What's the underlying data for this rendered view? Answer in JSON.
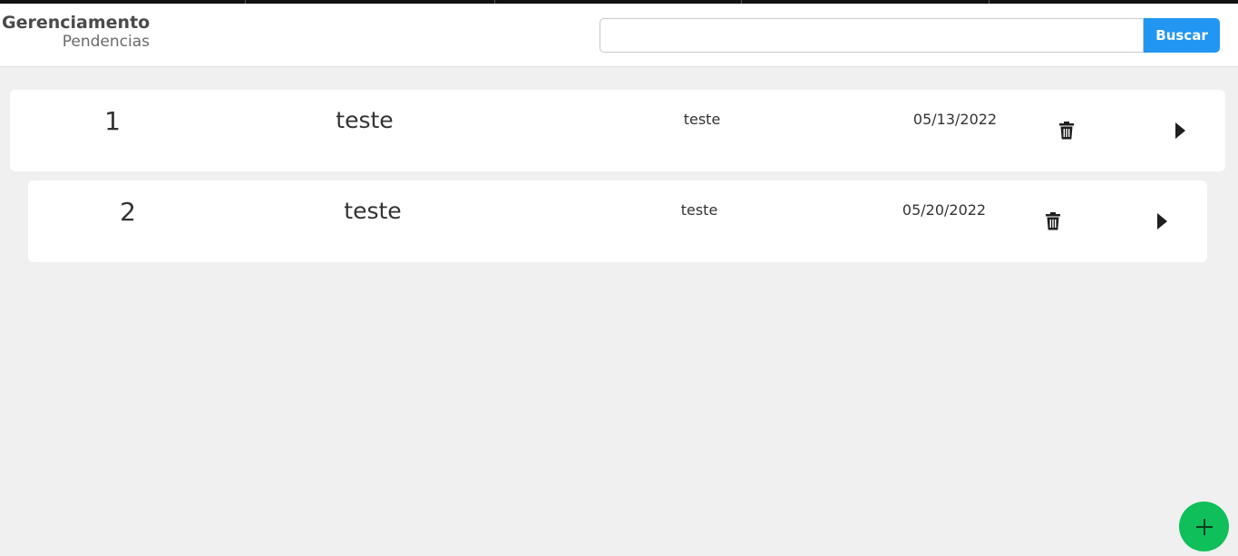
{
  "brand": {
    "title": "Gerenciamento",
    "subtitle": "Pendencias"
  },
  "search": {
    "value": "",
    "placeholder": "",
    "button_label": "Buscar"
  },
  "items": [
    {
      "number": "1",
      "title": "teste",
      "description": "teste",
      "date": "05/13/2022"
    },
    {
      "number": "2",
      "title": "teste",
      "description": "teste",
      "date": "05/20/2022"
    }
  ],
  "icons": {
    "delete": "trash-icon",
    "open": "play-icon",
    "add": "plus-icon"
  },
  "colors": {
    "accent": "#2196f3",
    "fab": "#0fbf5a",
    "background": "#f0f0f0",
    "card": "#ffffff"
  }
}
